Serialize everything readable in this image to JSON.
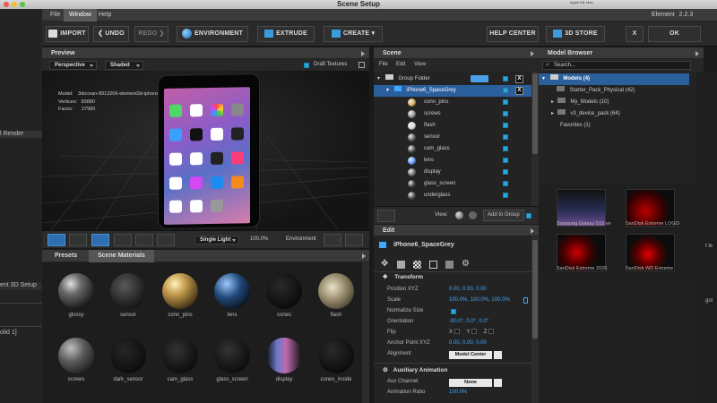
{
  "window": {
    "title": "Scene Setup",
    "sysinfo_line1": "Apple M1 Max",
    "sysinfo_line2": "65152 MB Video RAM",
    "element_label": "Element",
    "element_version": "2.2.3"
  },
  "menu": [
    "File",
    "Window",
    "Help"
  ],
  "toolbar": {
    "import": "IMPORT",
    "undo": "UNDO",
    "redo": "REDO",
    "environment": "ENVIRONMENT",
    "extrude": "EXTRUDE",
    "create": "CREATE",
    "help_center": "HELP CENTER",
    "store": "3D STORE",
    "close": "X",
    "ok": "OK"
  },
  "background_app": {
    "render_label": "l Render",
    "setup_label": "ent 3D Setup",
    "solid_label": "olid 1]",
    "right_frag1": "t le",
    "right_frag2": "gol",
    "right_frag3": "alm"
  },
  "preview": {
    "title": "Preview",
    "camera": "Perspective",
    "shading": "Shaded",
    "draft_textures": "Draft Textures",
    "model_label": "Model:",
    "model_value": "3docean-8913206-element3d-iphone-6/6 c4d",
    "vertices_label": "Vertices:",
    "vertices_value": "83880",
    "faces_label": "Faces:",
    "faces_value": "27960",
    "light_mode": "Single Light",
    "zoom": "100.0%",
    "environment": "Environment"
  },
  "materials": {
    "tabs": [
      "Presets",
      "Scene Materials"
    ],
    "items": [
      {
        "name": "glossy",
        "style": "glossy"
      },
      {
        "name": "sensor",
        "style": "sensor"
      },
      {
        "name": "conn_pins",
        "style": "gold"
      },
      {
        "name": "lens",
        "style": "lens"
      },
      {
        "name": "cones",
        "style": "dark"
      },
      {
        "name": "flash",
        "style": "flash"
      },
      {
        "name": "screws",
        "style": "screws"
      },
      {
        "name": "dark_sensor",
        "style": "darksensor"
      },
      {
        "name": "cam_glass",
        "style": "glass"
      },
      {
        "name": "glass_screen",
        "style": "glass"
      },
      {
        "name": "display",
        "style": "display"
      },
      {
        "name": "cones_inside",
        "style": "dark"
      }
    ]
  },
  "scene": {
    "title": "Scene",
    "menu": [
      "File",
      "Edit",
      "View"
    ],
    "group_folder": "Group Folder",
    "selected_model": "iPhone6_SpaceGrey",
    "objects": [
      "conn_pins",
      "screws",
      "flash",
      "sensor",
      "cam_glass",
      "lens",
      "display",
      "glass_screen",
      "underglass"
    ],
    "view_label": "View:",
    "add_to_group": "Add to Group"
  },
  "edit": {
    "title": "Edit",
    "model_name": "iPhone6_SpaceGrey",
    "transform_label": "Transform",
    "position_label": "Position XYZ",
    "position_values": [
      "0.00",
      "0.00",
      "0.00"
    ],
    "scale_label": "Scale",
    "scale_values": [
      "100.0%",
      "100.0%",
      "100.0%"
    ],
    "normalize_label": "Normalize Size",
    "orientation_label": "Orientation",
    "orientation_values": [
      "-90.0°",
      "0.0°",
      "0.0°"
    ],
    "flip_label": "Flip",
    "flip_axes": [
      "X",
      "Y",
      "Z"
    ],
    "anchor_label": "Anchor Point XYZ",
    "anchor_values": [
      "0.00",
      "0.00",
      "0.00"
    ],
    "alignment_label": "Alignment",
    "alignment_value": "Model Center",
    "aux_label": "Auxiliary Animation",
    "aux_channel_label": "Aux Channel",
    "aux_channel_value": "None",
    "anim_ratio_label": "Animation Ratio",
    "anim_ratio_value": "100.0%"
  },
  "model_browser": {
    "title": "Model Browser",
    "search_placeholder": "Search...",
    "root": "Models (4)",
    "folders": [
      "Starter_Pack_Physical (42)",
      "My_Models (10)",
      "v3_device_pack (64)"
    ],
    "favorites": "Favorites (1)",
    "thumbs": [
      "Samsung Galaxy S10 ve",
      "SanDisk Extreme LOGO",
      "SanDisk Extreme 2020",
      "SanDisk WD Extreme"
    ]
  }
}
